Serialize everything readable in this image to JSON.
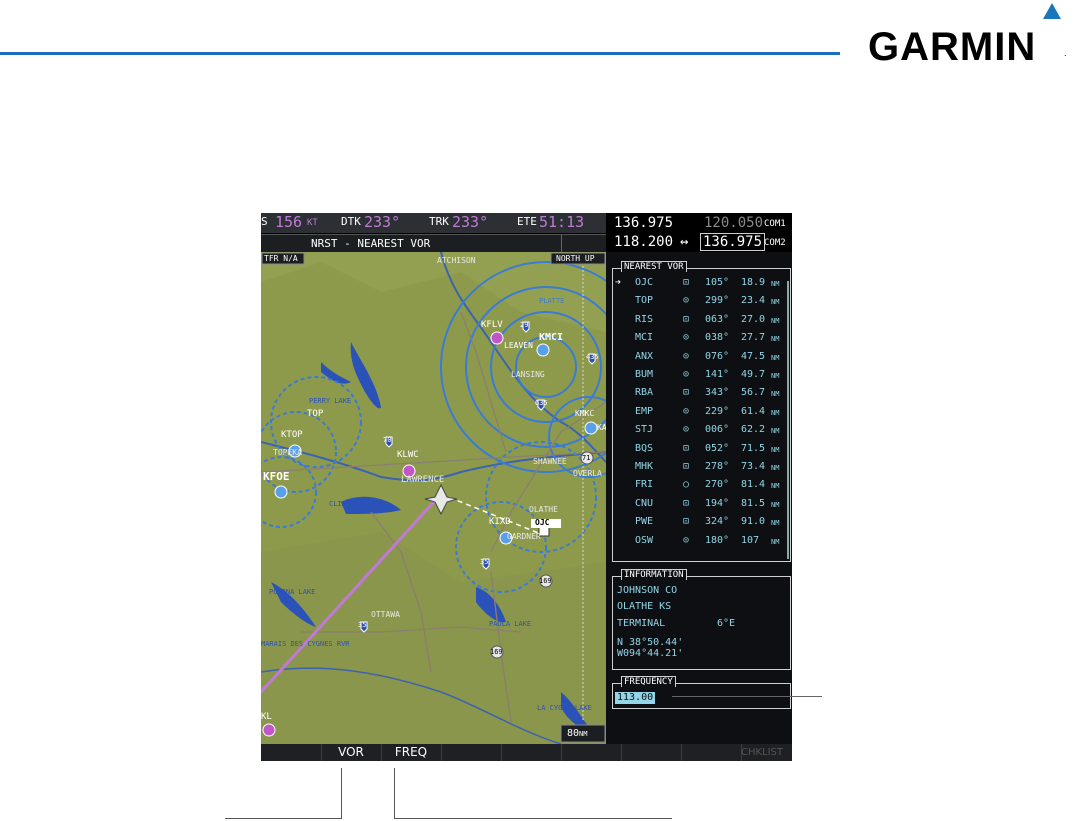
{
  "brand": {
    "name": "GARMIN",
    "reg": "."
  },
  "navbar": {
    "gs_prefix": "S",
    "gs_value": "156",
    "gs_unit": "KT",
    "dtk_label": "DTK",
    "dtk_value": "233°",
    "trk_label": "TRK",
    "trk_value": "233°",
    "ete_label": "ETE",
    "ete_value": "51:13"
  },
  "page_title": "NRST - NEAREST VOR",
  "com": {
    "com1_active": "136.975",
    "com1_standby": "120.050",
    "com1_label": "COM1",
    "com2_active": "118.200",
    "swap_symbol": "↔",
    "com2_standby": "136.975",
    "com2_label": "COM2"
  },
  "map": {
    "tfr_label": "TFR N/A",
    "orientation": "NORTH UP",
    "range": "80",
    "range_unit": "NM",
    "labels": {
      "atchison": "ATCHISON",
      "kflv": "KFLV",
      "leaven": "LEAVEN",
      "kmci": "KMCI",
      "lansing": "LANSING",
      "perry_lake": "PERRY LAKE",
      "top": "TOP",
      "ktop": "KTOP",
      "topeka": "TOPEKA",
      "klwc": "KLWC",
      "lawrence": "LAWRENCE",
      "kfoe": "KFOE",
      "clinton_lake": "CLINTON LAKE",
      "kmkc": "KMKC",
      "kc": "KA",
      "olathe": "OLATHE",
      "kixd": "KIXD",
      "ojc": "OJC",
      "gardner": "GARDNER",
      "pomona_lake": "POMONA LAKE",
      "ottawa": "OTTAWA",
      "paola_lake": "PAOLA LAKE",
      "la_cygne_lake": "LA CYGNE LAKE",
      "kl": "KL",
      "marais": "MARAIS DES CYGNES RVR",
      "overland": "OVERLA",
      "shawnee": "SHAWNEE",
      "platte": "PLATTE"
    },
    "highway_numbers": [
      "29",
      "435",
      "635",
      "70",
      "35",
      "169",
      "35",
      "169",
      "71"
    ]
  },
  "nearest_vor": {
    "label": "NEAREST VOR",
    "selected_marker": "➔",
    "rows": [
      {
        "id": "OJC",
        "sym": "⊡",
        "brg": "105°",
        "dist": "18.9",
        "unit": "NM"
      },
      {
        "id": "TOP",
        "sym": "⊙",
        "brg": "299°",
        "dist": "23.4",
        "unit": "NM"
      },
      {
        "id": "RIS",
        "sym": "⊡",
        "brg": "063°",
        "dist": "27.0",
        "unit": "NM"
      },
      {
        "id": "MCI",
        "sym": "⊙",
        "brg": "038°",
        "dist": "27.7",
        "unit": "NM"
      },
      {
        "id": "ANX",
        "sym": "⊙",
        "brg": "076°",
        "dist": "47.5",
        "unit": "NM"
      },
      {
        "id": "BUM",
        "sym": "⊙",
        "brg": "141°",
        "dist": "49.7",
        "unit": "NM"
      },
      {
        "id": "RBA",
        "sym": "⊡",
        "brg": "343°",
        "dist": "56.7",
        "unit": "NM"
      },
      {
        "id": "EMP",
        "sym": "⊙",
        "brg": "229°",
        "dist": "61.4",
        "unit": "NM"
      },
      {
        "id": "STJ",
        "sym": "⊙",
        "brg": "006°",
        "dist": "62.2",
        "unit": "NM"
      },
      {
        "id": "BQS",
        "sym": "⊡",
        "brg": "052°",
        "dist": "71.5",
        "unit": "NM"
      },
      {
        "id": "MHK",
        "sym": "⊡",
        "brg": "278°",
        "dist": "73.4",
        "unit": "NM"
      },
      {
        "id": "FRI",
        "sym": "○",
        "brg": "270°",
        "dist": "81.4",
        "unit": "NM"
      },
      {
        "id": "CNU",
        "sym": "⊡",
        "brg": "194°",
        "dist": "81.5",
        "unit": "NM"
      },
      {
        "id": "PWE",
        "sym": "⊡",
        "brg": "324°",
        "dist": "91.0",
        "unit": "NM"
      },
      {
        "id": "OSW",
        "sym": "⊙",
        "brg": "180°",
        "dist": "107",
        "unit": "NM"
      }
    ]
  },
  "information": {
    "label": "INFORMATION",
    "name": "JOHNSON CO",
    "city": "OLATHE KS",
    "class": "TERMINAL",
    "mag_var": "6°E",
    "lat": "N 38°50.44'",
    "lon": "W094°44.21'"
  },
  "frequency": {
    "label": "FREQUENCY",
    "value": "113.00"
  },
  "softkeys": [
    "",
    "VOR",
    "FREQ",
    "",
    "",
    "",
    "",
    "",
    "CHKLIST"
  ],
  "colors": {
    "map_terrain": "#8e9a4b",
    "water": "#2a52b8",
    "airspace": "#3a7bd5",
    "vor_text": "#93d6e8",
    "magenta": "#c07ad6"
  }
}
